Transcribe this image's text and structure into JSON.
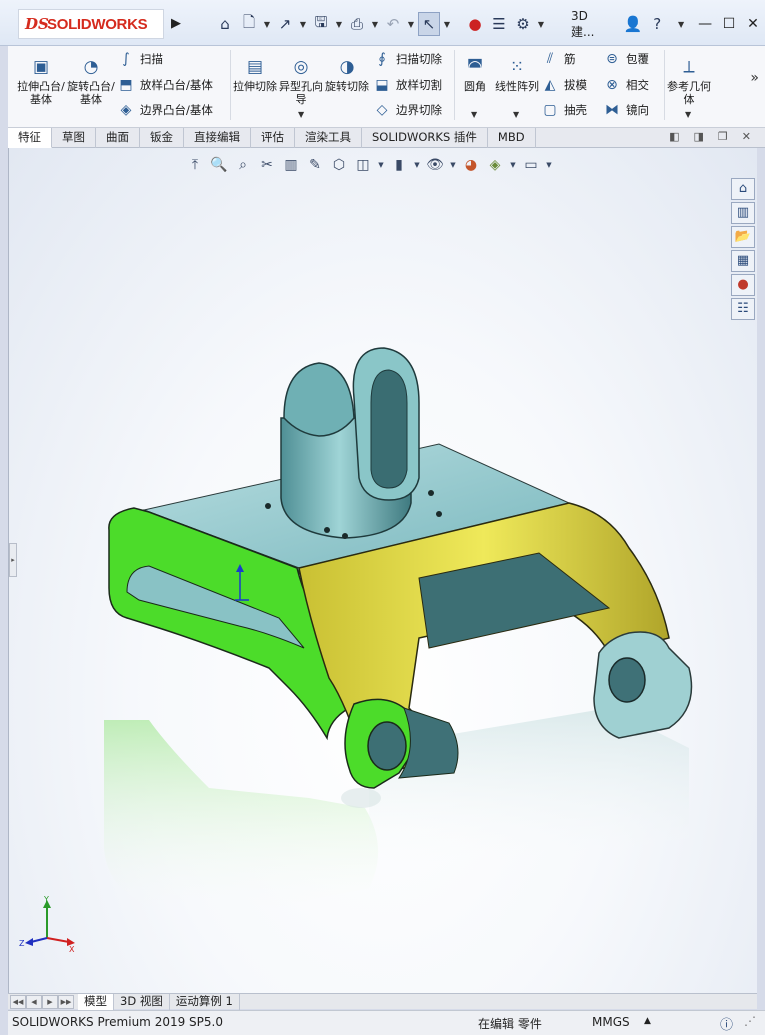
{
  "app": {
    "brand": "SOLIDWORKS",
    "brand_mark": "DS",
    "doc_title": "3D建...",
    "product": "SOLIDWORKS Premium 2019 SP5.0",
    "accent": "#d52b1e"
  },
  "quick_toolbar": {
    "icons": [
      "home-icon",
      "new-document-icon",
      "open-icon",
      "save-icon",
      "print-icon",
      "undo-icon",
      "select-arrow-icon",
      "rebuild-icon",
      "file-properties-icon",
      "options-icon"
    ]
  },
  "title_controls": {
    "user": "user-icon",
    "help": "?",
    "minimize": "—",
    "maximize": "☐",
    "close": "✕"
  },
  "command_manager": {
    "big_buttons": [
      {
        "label": "拉伸凸台/基体",
        "icon": "extruded-boss-icon"
      },
      {
        "label": "旋转凸台/基体",
        "icon": "revolved-boss-icon"
      },
      {
        "label": "拉伸切除",
        "icon": "extruded-cut-icon"
      },
      {
        "label": "异型孔向导",
        "icon": "hole-wizard-icon"
      },
      {
        "label": "旋转切除",
        "icon": "revolved-cut-icon"
      },
      {
        "label": "圆角",
        "icon": "fillet-icon"
      },
      {
        "label": "线性阵列",
        "icon": "linear-pattern-icon"
      },
      {
        "label": "参考几何体",
        "icon": "reference-geometry-icon"
      }
    ],
    "small_buttons": [
      {
        "label": "扫描",
        "icon": "swept-boss-icon"
      },
      {
        "label": "放样凸台/基体",
        "icon": "lofted-boss-icon"
      },
      {
        "label": "边界凸台/基体",
        "icon": "boundary-boss-icon"
      },
      {
        "label": "扫描切除",
        "icon": "swept-cut-icon"
      },
      {
        "label": "放样切割",
        "icon": "lofted-cut-icon"
      },
      {
        "label": "边界切除",
        "icon": "boundary-cut-icon"
      },
      {
        "label": "筋",
        "icon": "rib-icon"
      },
      {
        "label": "拔模",
        "icon": "draft-icon"
      },
      {
        "label": "抽壳",
        "icon": "shell-icon"
      },
      {
        "label": "包覆",
        "icon": "wrap-icon"
      },
      {
        "label": "相交",
        "icon": "intersect-icon"
      },
      {
        "label": "镜向",
        "icon": "mirror-icon"
      }
    ]
  },
  "tabs": [
    "特征",
    "草图",
    "曲面",
    "钣金",
    "直接编辑",
    "评估",
    "渲染工具",
    "SOLIDWORKS 插件",
    "MBD"
  ],
  "active_tab": "特征",
  "bottom_tabs": [
    "模型",
    "3D 视图",
    "运动算例 1"
  ],
  "active_bottom_tab": "模型",
  "status_bar": {
    "editing": "在编辑 零件",
    "units": "MMGS"
  },
  "model_colors": {
    "body": "#8fcfd0",
    "green_face": "#4cdc2a",
    "yellow_face": "#d7d23a"
  }
}
